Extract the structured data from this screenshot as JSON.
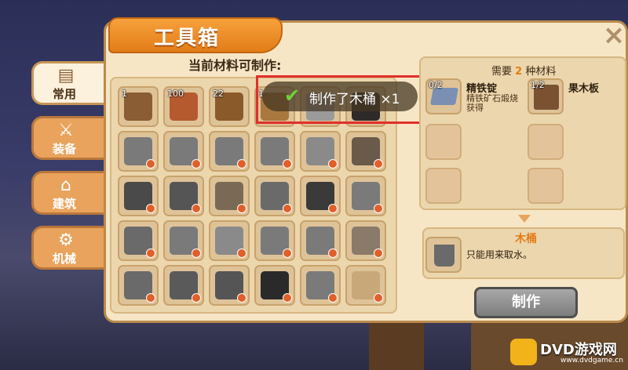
{
  "window": {
    "title": "工具箱",
    "close_label": "×"
  },
  "sidebar": {
    "tabs": [
      {
        "label": "常用",
        "icon": "planks-icon",
        "active": true
      },
      {
        "label": "装备",
        "icon": "sword-icon",
        "active": false
      },
      {
        "label": "建筑",
        "icon": "house-icon",
        "active": false
      },
      {
        "label": "机械",
        "icon": "gears-icon",
        "active": false
      }
    ]
  },
  "main": {
    "subtitle": "当前材料可制作:",
    "toast": {
      "text": "制作了木桶 ×1",
      "icon": "checkmark-icon"
    },
    "items": [
      {
        "name": "workbench",
        "count": "1",
        "color": "#8a5d34"
      },
      {
        "name": "brick",
        "count": "100",
        "color": "#b55a2f"
      },
      {
        "name": "stick",
        "count": "22",
        "color": "#8b5a2b"
      },
      {
        "name": "bowl",
        "count": "1",
        "color": "#a8783e"
      },
      {
        "name": "stone",
        "count": "",
        "color": "#9a9a9a"
      },
      {
        "name": "coal-block",
        "count": "",
        "color": "#2f2a2a"
      },
      {
        "name": "axe",
        "count": "",
        "color": "#7a7a7a"
      },
      {
        "name": "pickaxe",
        "count": "",
        "color": "#7a7a7a"
      },
      {
        "name": "shovel",
        "count": "",
        "color": "#7a7a7a"
      },
      {
        "name": "pickaxe-2",
        "count": "",
        "color": "#7a7a7a"
      },
      {
        "name": "furnace",
        "count": "",
        "color": "#8a8a8a"
      },
      {
        "name": "torch",
        "count": "",
        "color": "#6a5a4a"
      },
      {
        "name": "chest",
        "count": "",
        "color": "#4a4a4a"
      },
      {
        "name": "door",
        "count": "",
        "color": "#555555"
      },
      {
        "name": "ladder",
        "count": "",
        "color": "#7a6a55"
      },
      {
        "name": "bed",
        "count": "",
        "color": "#6a6a6a"
      },
      {
        "name": "sign",
        "count": "",
        "color": "#3a3a3a"
      },
      {
        "name": "hatchet",
        "count": "",
        "color": "#7a7a7a"
      },
      {
        "name": "saw",
        "count": "",
        "color": "#6a6a6a"
      },
      {
        "name": "pickaxe-3",
        "count": "",
        "color": "#7a7a7a"
      },
      {
        "name": "drill",
        "count": "",
        "color": "#8a8a8a"
      },
      {
        "name": "shovel-2",
        "count": "",
        "color": "#7a7a7a"
      },
      {
        "name": "pickaxe-4",
        "count": "",
        "color": "#7a7a7a"
      },
      {
        "name": "ore-bowl",
        "count": "",
        "color": "#8a7a6a"
      },
      {
        "name": "stone-pile",
        "count": "",
        "color": "#6a6a6a"
      },
      {
        "name": "anvil",
        "count": "",
        "color": "#5a5a5a"
      },
      {
        "name": "ore-block",
        "count": "",
        "color": "#555555"
      },
      {
        "name": "dark-block",
        "count": "",
        "color": "#2a2a2a"
      },
      {
        "name": "cabinet",
        "count": "",
        "color": "#7a7a7a"
      },
      {
        "name": "bottle",
        "count": "",
        "color": "#c8a878"
      }
    ]
  },
  "recipe": {
    "need_prefix": "需要",
    "need_count": "2",
    "need_suffix": "种材料",
    "materials": [
      {
        "count": "0/2",
        "name": "精铁锭",
        "desc": "精铁矿石煅烧获得",
        "icon": "iron-ingot-icon",
        "color": "#7b8fb2"
      },
      {
        "count": "1/2",
        "name": "果木板",
        "desc": "",
        "icon": "wood-plank-icon",
        "color": "#7a5232"
      }
    ],
    "result": {
      "name": "木桶",
      "desc": "只能用来取水。",
      "icon": "bucket-icon",
      "color": "#6a6a6a"
    },
    "craft_label": "制作"
  },
  "watermark": {
    "brand": "DVD游戏网",
    "url": "www.dvdgame.cn"
  }
}
